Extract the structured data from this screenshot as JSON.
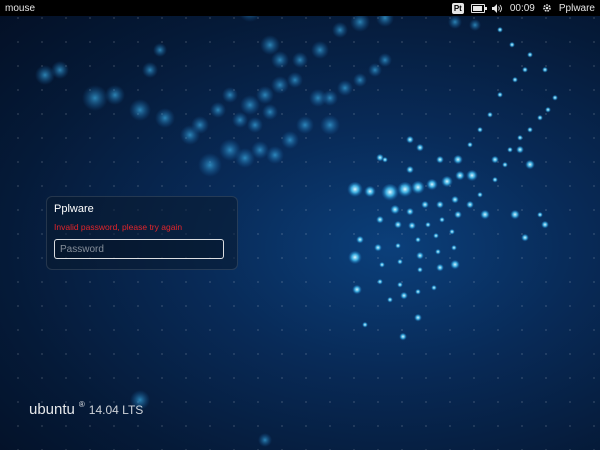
{
  "topbar": {
    "hostname": "mouse",
    "keyboard_layout": "Pt",
    "battery_level": 0.8,
    "time": "00:09",
    "username": "Pplware",
    "icons": [
      "keyboard-layout-icon",
      "battery-icon",
      "volume-icon",
      "settings-gear-icon"
    ]
  },
  "login": {
    "user_name": "Pplware",
    "error_message": "Invalid password, please try again",
    "password_placeholder": "Password",
    "password_value": ""
  },
  "branding": {
    "name": "ubuntu",
    "registered_mark": "®",
    "version": "14.04 LTS"
  },
  "colors": {
    "background": "#082a57",
    "error": "#e4252b",
    "topbar": "#000000"
  }
}
